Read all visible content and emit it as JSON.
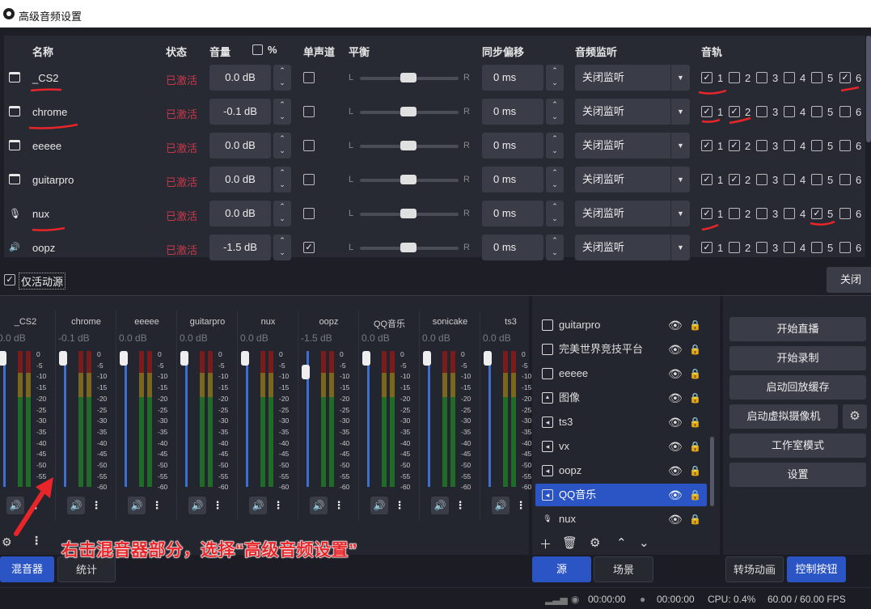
{
  "dialog": {
    "title": "高级音频设置",
    "headers": {
      "name": "名称",
      "status": "状态",
      "volume": "音量",
      "percent": "%",
      "mono": "单声道",
      "balance": "平衡",
      "sync_offset": "同步偏移",
      "monitoring": "音频监听",
      "tracks": "音轨"
    },
    "balance_L": "L",
    "balance_R": "R",
    "rows": [
      {
        "name": "_CS2",
        "status": "已激活",
        "volume": "0.0 dB",
        "mono": false,
        "sync": "0 ms",
        "monitor": "关闭监听",
        "tracks": [
          true,
          false,
          false,
          false,
          false,
          true
        ],
        "icon": "window-capture-icon"
      },
      {
        "name": "chrome",
        "status": "已激活",
        "volume": "-0.1 dB",
        "mono": false,
        "sync": "0 ms",
        "monitor": "关闭监听",
        "tracks": [
          true,
          true,
          false,
          false,
          false,
          false
        ],
        "icon": "window-capture-icon"
      },
      {
        "name": "eeeee",
        "status": "已激活",
        "volume": "0.0 dB",
        "mono": false,
        "sync": "0 ms",
        "monitor": "关闭监听",
        "tracks": [
          true,
          true,
          false,
          false,
          false,
          false
        ],
        "icon": "window-capture-icon"
      },
      {
        "name": "guitarpro",
        "status": "已激活",
        "volume": "0.0 dB",
        "mono": false,
        "sync": "0 ms",
        "monitor": "关闭监听",
        "tracks": [
          true,
          true,
          false,
          false,
          false,
          false
        ],
        "icon": "window-capture-icon"
      },
      {
        "name": "nux",
        "status": "已激活",
        "volume": "0.0 dB",
        "mono": false,
        "sync": "0 ms",
        "monitor": "关闭监听",
        "tracks": [
          true,
          false,
          false,
          false,
          true,
          false
        ],
        "icon": "microphone-icon"
      },
      {
        "name": "oopz",
        "status": "已激活",
        "volume": "-1.5 dB",
        "mono": true,
        "sync": "0 ms",
        "monitor": "关闭监听",
        "tracks": [
          true,
          false,
          false,
          false,
          false,
          false
        ],
        "icon": "speaker-icon"
      }
    ],
    "track_numbers": [
      "1",
      "2",
      "3",
      "4",
      "5",
      "6"
    ],
    "active_only_label": "仅活动源",
    "active_only_checked": true,
    "close_label": "关闭"
  },
  "mixer": {
    "channels": [
      {
        "name": "_CS2",
        "db": "0.0 dB",
        "level": 1.0
      },
      {
        "name": "chrome",
        "db": "-0.1 dB",
        "level": 1.0
      },
      {
        "name": "eeeee",
        "db": "0.0 dB",
        "level": 1.0
      },
      {
        "name": "guitarpro",
        "db": "0.0 dB",
        "level": 1.0
      },
      {
        "name": "nux",
        "db": "0.0 dB",
        "level": 1.0
      },
      {
        "name": "oopz",
        "db": "-1.5 dB",
        "level": 0.9
      },
      {
        "name": "QQ音乐",
        "db": "0.0 dB",
        "level": 1.0
      },
      {
        "name": "sonicake",
        "db": "0.0 dB",
        "level": 1.0
      },
      {
        "name": "ts3",
        "db": "0.0 dB",
        "level": 1.0
      }
    ],
    "ticks": [
      "0",
      "-5",
      "-10",
      "-15",
      "-20",
      "-25",
      "-30",
      "-35",
      "-40",
      "-45",
      "-50",
      "-55",
      "-60"
    ]
  },
  "sources": {
    "items": [
      {
        "name": "guitarpro",
        "icon": "window-icon",
        "selected": false
      },
      {
        "name": "完美世界竞技平台",
        "icon": "window-icon",
        "selected": false
      },
      {
        "name": "eeeee",
        "icon": "window-icon",
        "selected": false
      },
      {
        "name": "图像",
        "icon": "image-icon",
        "selected": false
      },
      {
        "name": "ts3",
        "icon": "speaker-icon",
        "selected": false
      },
      {
        "name": "vx",
        "icon": "speaker-icon",
        "selected": false
      },
      {
        "name": "oopz",
        "icon": "speaker-icon",
        "selected": false
      },
      {
        "name": "QQ音乐",
        "icon": "speaker-icon",
        "selected": true
      },
      {
        "name": "nux",
        "icon": "microphone-icon",
        "selected": false
      }
    ]
  },
  "controls": {
    "start_stream": "开始直播",
    "start_record": "开始录制",
    "replay_buffer": "启动回放缓存",
    "virtual_cam": "启动虚拟摄像机",
    "studio_mode": "工作室模式",
    "settings": "设置"
  },
  "tabs": {
    "mixer": "混音器",
    "stats": "统计",
    "sources": "源",
    "scenes": "场景",
    "transitions": "转场动画",
    "controls": "控制按钮"
  },
  "status": {
    "rec_time1": "00:00:00",
    "rec_time2": "00:00:00",
    "cpu": "CPU: 0.4%",
    "fps": "60.00 / 60.00 FPS"
  },
  "annotation": "右击混音器部分，选择“高级音频设置”",
  "colors": {
    "accent": "#2b54c4",
    "status_active": "#c8384a",
    "annotation": "#e8262a"
  }
}
